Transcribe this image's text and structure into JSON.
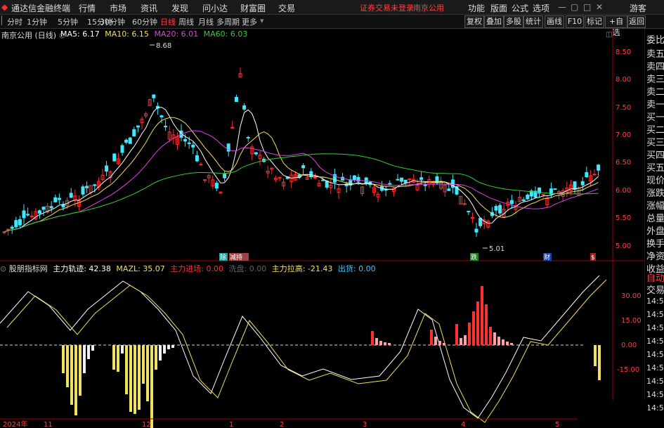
{
  "menu": {
    "app_title": "通达信金融终端",
    "items": [
      "行情",
      "市场",
      "资讯",
      "发现",
      "问小达",
      "财富圈",
      "交易"
    ],
    "notice": "证券交易未登录",
    "stock_link": "南京公用",
    "right_items": [
      "功能",
      "版面",
      "公式",
      "选项"
    ],
    "user": "游客"
  },
  "periods": [
    "分时",
    "1分钟",
    "5分钟",
    "15分钟",
    "30分钟",
    "60分钟",
    "日线",
    "周线",
    "月线",
    "多周期",
    "更多"
  ],
  "active_period": "日线",
  "toolbar": [
    "复权",
    "叠加",
    "多股",
    "统计",
    "画线",
    "F10",
    "标记",
    "+自选",
    "返回"
  ],
  "main_chart": {
    "stock_title": "南京公用 (日线)",
    "ma": [
      {
        "label": "MA5: 6.17",
        "color": "#ffffff"
      },
      {
        "label": "MA10: 6.15",
        "color": "#f0e060"
      },
      {
        "label": "MA20: 6.01",
        "color": "#e040e0"
      },
      {
        "label": "MA60: 6.03",
        "color": "#30d030"
      }
    ],
    "price_ticks": [
      "8.50",
      "8.00",
      "7.50",
      "7.00",
      "6.50",
      "6.00",
      "5.50",
      "5.00"
    ],
    "high_label": "8.68",
    "low_label": "5.01",
    "event_marks": [
      "除",
      "减",
      "减持",
      "跌",
      "财",
      "$"
    ]
  },
  "indicator": {
    "name": "股朋指标网",
    "values": [
      {
        "label": "主力轨迹: 42.38",
        "color": "#ffffff"
      },
      {
        "label": "MAZL: 35.07",
        "color": "#f0e060"
      },
      {
        "label": "主力进场: 0.00",
        "color": "#ff3030"
      },
      {
        "label": "洗盘: 0.00",
        "color": "#606060"
      },
      {
        "label": "主力拉高: -21.43",
        "color": "#f0e060"
      },
      {
        "label": "出货: 0.00",
        "color": "#40c8ff"
      }
    ],
    "ticks": [
      "30.00",
      "15.00",
      "0.00",
      "-15.00"
    ]
  },
  "right_panel": {
    "labels": [
      "委比",
      "卖五",
      "卖四",
      "卖三",
      "卖二",
      "卖一",
      "买一",
      "买二",
      "买三",
      "买四",
      "买五",
      "现价",
      "涨跌",
      "涨幅",
      "总量",
      "外盘",
      "换手",
      "净资",
      "收益"
    ],
    "auto_trade": [
      "自动",
      "交易"
    ],
    "times": [
      "14:56",
      "14:56",
      "14:56",
      "14:56",
      "14:56",
      "14:56",
      "14:56",
      "14:56",
      "14:56"
    ]
  },
  "time_axis": [
    "2024年",
    "11",
    "12",
    "1",
    "2",
    "3",
    "4",
    "5"
  ],
  "colors": {
    "up": "#ff3030",
    "down": "#40e8ff",
    "ma5": "#ffffff",
    "ma10": "#f0e060",
    "ma20": "#e040e0",
    "ma60": "#30d030",
    "axis": "#a00000"
  }
}
